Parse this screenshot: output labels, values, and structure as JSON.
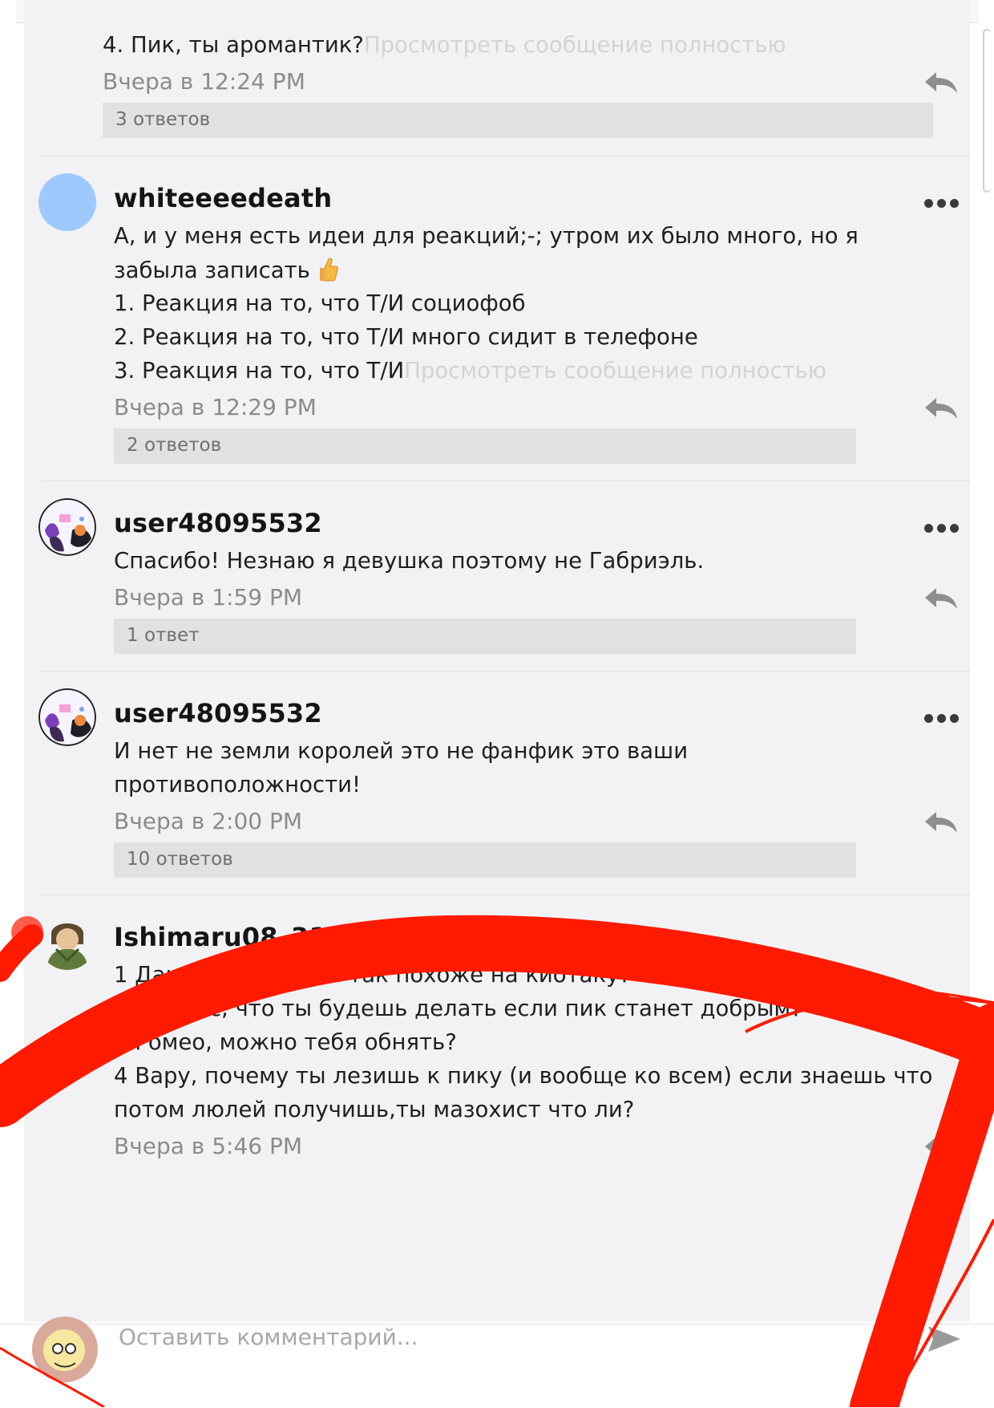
{
  "comments": [
    {
      "lines": [
        "4. Пик, ты аромантик?"
      ],
      "read_more": "Просмотреть сообщение полностью",
      "timestamp": "Вчера в 12:24 PM",
      "replies": "3 ответов"
    },
    {
      "username": "whiteeeedeath",
      "lines": [
        "А, и у меня есть идеи для реакций;-; утром их было много, но я",
        "забыла записать",
        "1. Реакция на то, что Т/И социофоб",
        "2. Реакция на то, что Т/И много сидит в телефоне",
        "3. Реакция на то, что Т/И"
      ],
      "read_more": "Просмотреть сообщение полностью",
      "timestamp": "Вчера в 12:29 PM",
      "replies": "2 ответов"
    },
    {
      "username": "user48095532",
      "lines": [
        "Спасибо! Незнаю я девушка поэтому не Габриэль."
      ],
      "timestamp": "Вчера в 1:59 PM",
      "replies": "1 ответ"
    },
    {
      "username": "user48095532",
      "lines": [
        "И нет не земли королей это не фанфик это ваши",
        "противоположности!"
      ],
      "timestamp": "Вчера в 2:00 PM",
      "replies": "10 ответов"
    },
    {
      "username": "Ishimaru08_31",
      "lines": [
        "1 Данте, почему ты так похоже на киотаку?",
        "2 Феликс, что ты будешь делать если пик станет добрым?",
        "3 Ромео, можно тебя обнять?",
        "4 Вару, почему ты лезишь к пику (и вообще ко всем) если знаешь что",
        "потом люлей получишь,ты мазохист что ли?"
      ],
      "timestamp": "Вчера в 5:46 PM"
    }
  ],
  "input": {
    "placeholder": "Оставить комментарий..."
  },
  "colors": {
    "panel": "#f2f2f4",
    "annotation": "#ff1a00",
    "avatar_blue": "#9ec9ff"
  },
  "icons": {
    "more": "more-dots-icon",
    "reply": "reply-arrow-icon",
    "send": "send-icon",
    "thumbs": "thumbs-up-emoji-icon"
  }
}
